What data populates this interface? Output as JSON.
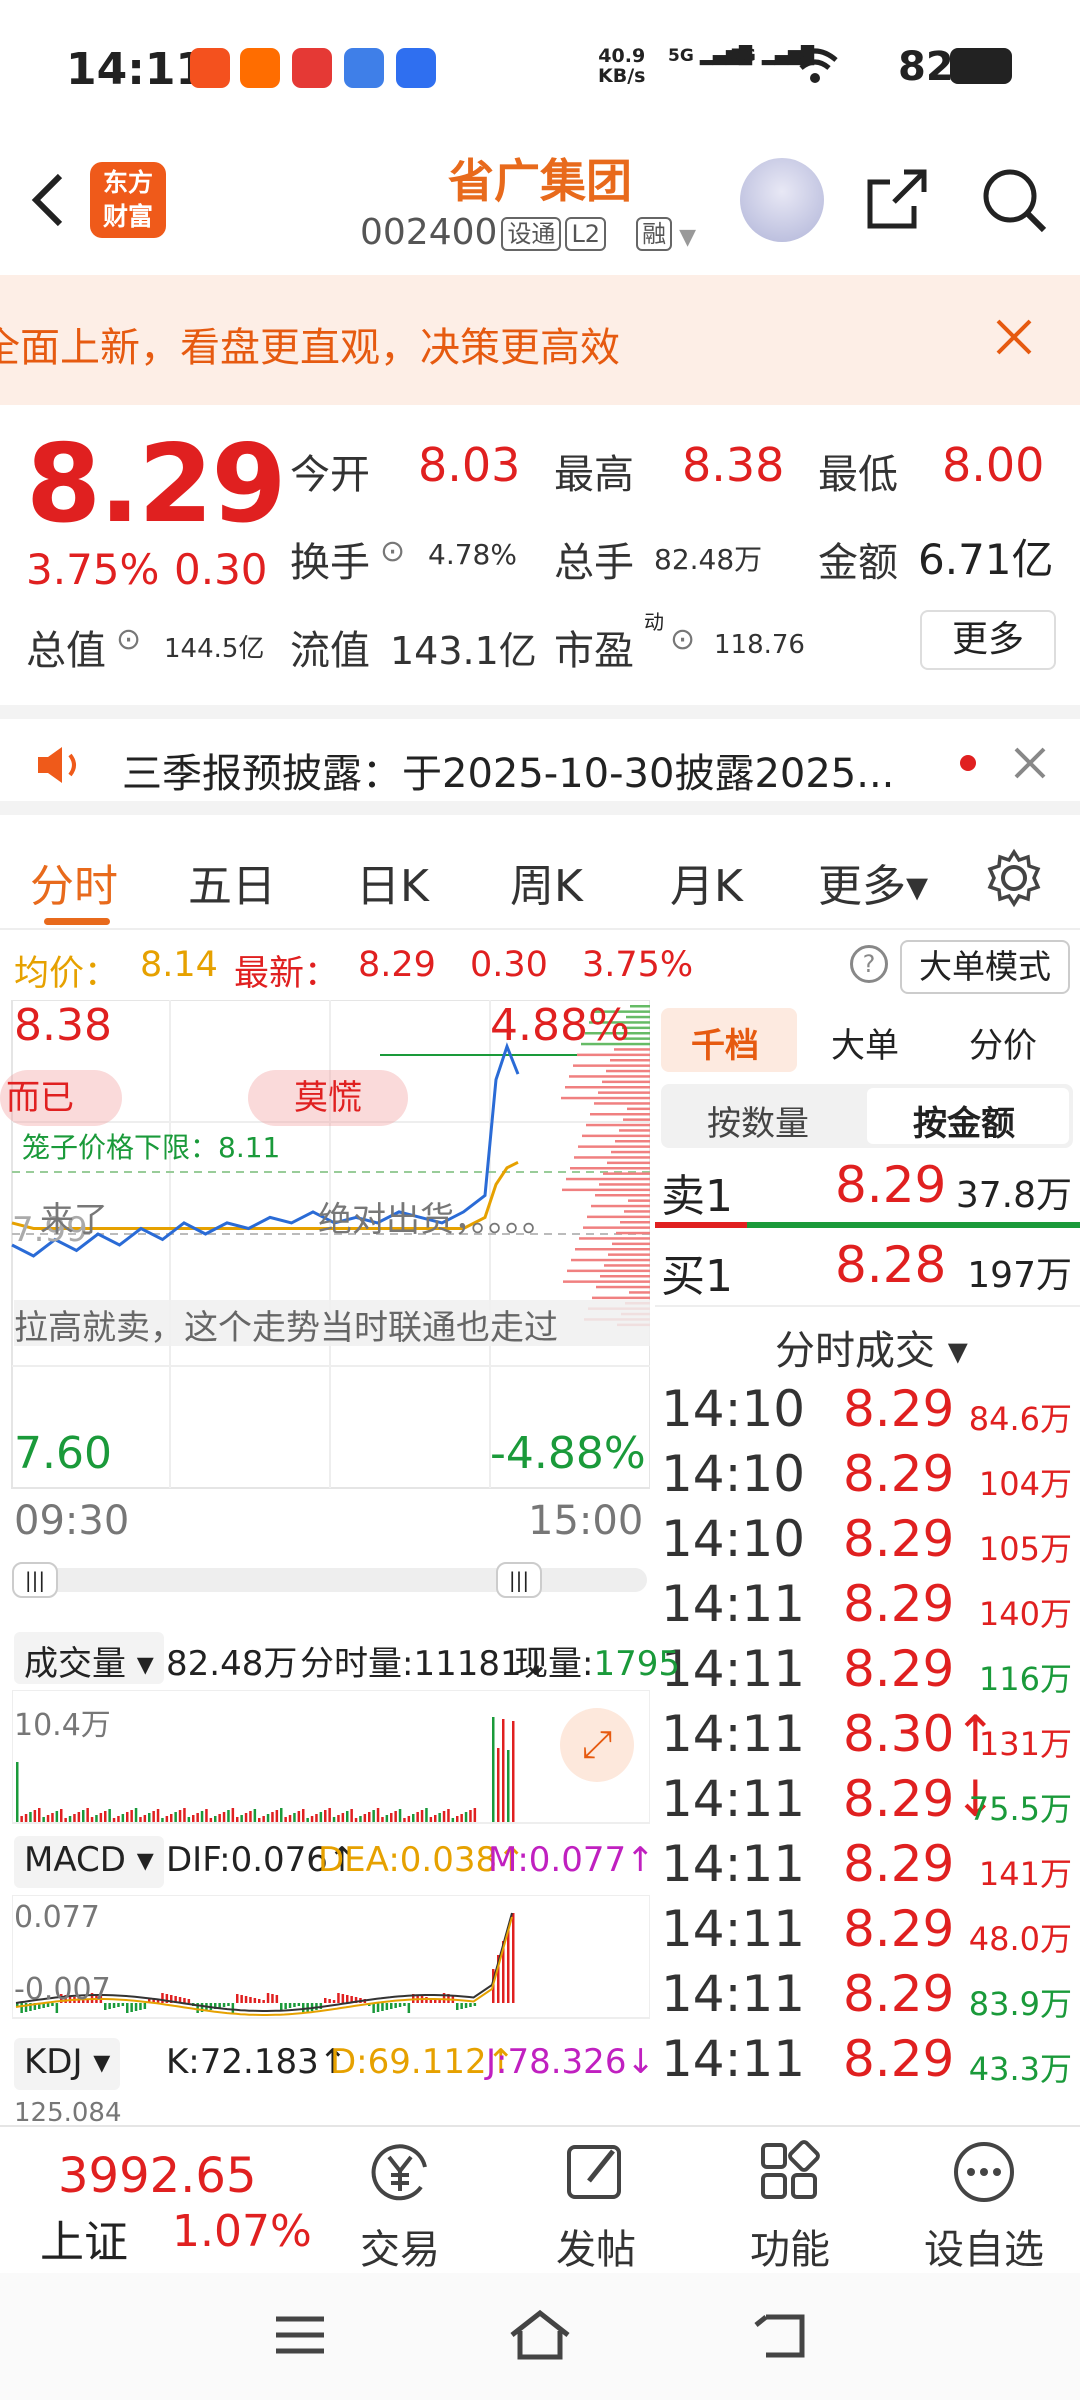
{
  "status_bar": {
    "time": "14:11",
    "net_speed_value": "40.9",
    "net_speed_unit": "KB/s",
    "sig1": "5G",
    "sig2": "5G",
    "battery": "82%"
  },
  "header": {
    "logo_line1": "东方",
    "logo_line2": "财富",
    "title": "省广集团",
    "code": "002400",
    "tag1": "设通",
    "tag2": "L2",
    "tag3": "融"
  },
  "banner": {
    "text": "全面上新，看盘更直观，决策更高效"
  },
  "quote": {
    "price": "8.29",
    "change_pct": "3.75%",
    "change": "0.30",
    "open_label": "今开",
    "open": "8.03",
    "high_label": "最高",
    "high": "8.38",
    "low_label": "最低",
    "low": "8.00",
    "turnover_label": "换手",
    "turnover": "4.78%",
    "volume_label": "总手",
    "volume": "82.48万",
    "amount_label": "金额",
    "amount": "6.71亿",
    "mcap_label": "总值",
    "mcap": "144.5亿",
    "float_label": "流值",
    "float": "143.1亿",
    "pe_label": "市盈",
    "pe_sup": "动",
    "pe": "118.76",
    "more": "更多"
  },
  "notice": {
    "text": "三季报预披露：于2025-10-30披露2025..."
  },
  "tabs": [
    {
      "label": "分时"
    },
    {
      "label": "五日"
    },
    {
      "label": "日K"
    },
    {
      "label": "周K"
    },
    {
      "label": "月K"
    },
    {
      "label": "更多▾"
    }
  ],
  "info_row": {
    "avg_label": "均价：",
    "avg": "8.14",
    "latest_label": "最新：",
    "latest": "8.29",
    "change": "0.30",
    "pct": "3.75%",
    "big_mode": "大单模式"
  },
  "chart": {
    "high": "8.38",
    "high_pct": "4.88%",
    "low": "7.60",
    "low_pct": "-4.88%",
    "ref": "7.99",
    "limit_line": "笼子价格下限：8.11",
    "t_start": "09:30",
    "t_end": "15:00",
    "danmu1": "而已",
    "danmu2": "莫慌",
    "danmu3": "来了",
    "danmu4": "绝对出货，。。。。",
    "danmu5": "拉高就卖，这个走势当时联通也走过"
  },
  "chart_data": {
    "type": "line",
    "title": "",
    "xlabel": "",
    "ylabel": "",
    "x_range": [
      "09:30",
      "15:00"
    ],
    "ylim": [
      7.6,
      8.38
    ],
    "reference_price": 7.99,
    "series": [
      {
        "values": [
          7.99,
          7.97,
          8.0,
          7.98,
          8.01,
          7.99,
          8.02,
          8.0,
          8.03,
          8.01,
          8.03,
          8.02,
          8.04,
          8.03,
          8.05,
          8.03,
          8.04,
          8.03,
          8.05,
          8.04,
          8.03,
          8.05,
          8.08,
          8.29,
          8.35,
          8.3
        ]
      },
      {
        "values": [
          8.03,
          8.02,
          8.02,
          8.02,
          8.02,
          8.02,
          8.02,
          8.02,
          8.02,
          8.02,
          8.02,
          8.02,
          8.02,
          8.02,
          8.02,
          8.02,
          8.02,
          8.02,
          8.02,
          8.02,
          8.02,
          8.02,
          8.04,
          8.1,
          8.13,
          8.14
        ]
      }
    ]
  },
  "right_panel": {
    "seg1": "千档",
    "seg2": "大单",
    "seg3": "分价",
    "btn1": "按数量",
    "btn2": "按金额",
    "sell_label": "卖1",
    "sell_price": "8.29",
    "sell_vol": "37.8万",
    "buy_label": "买1",
    "buy_price": "8.28",
    "buy_vol": "197万",
    "trades_title": "分时成交 ▾",
    "trades": [
      {
        "time": "14:10",
        "price": "8.29",
        "vol": "84.6万",
        "pc": "red",
        "vc": "red"
      },
      {
        "time": "14:10",
        "price": "8.29",
        "vol": "104万",
        "pc": "red",
        "vc": "red"
      },
      {
        "time": "14:10",
        "price": "8.29",
        "vol": "105万",
        "pc": "red",
        "vc": "red"
      },
      {
        "time": "14:11",
        "price": "8.29",
        "vol": "140万",
        "pc": "red",
        "vc": "red"
      },
      {
        "time": "14:11",
        "price": "8.29",
        "vol": "116万",
        "pc": "red",
        "vc": "green"
      },
      {
        "time": "14:11",
        "price": "8.30↑",
        "vol": "131万",
        "pc": "red",
        "vc": "red"
      },
      {
        "time": "14:11",
        "price": "8.29↓",
        "vol": "75.5万",
        "pc": "red",
        "vc": "green"
      },
      {
        "time": "14:11",
        "price": "8.29",
        "vol": "141万",
        "pc": "red",
        "vc": "red"
      },
      {
        "time": "14:11",
        "price": "8.29",
        "vol": "48.0万",
        "pc": "red",
        "vc": "red"
      },
      {
        "time": "14:11",
        "price": "8.29",
        "vol": "83.9万",
        "pc": "red",
        "vc": "green"
      },
      {
        "time": "14:11",
        "price": "8.29",
        "vol": "43.3万",
        "pc": "red",
        "vc": "green"
      }
    ]
  },
  "indicators": {
    "vol_select": "成交量 ▾",
    "vol_total": "82.48万",
    "vol_tick_label": "分时量:",
    "vol_tick": "11181↓",
    "vol_now_label": "现量:",
    "vol_now": "1795",
    "vol_max": "10.4万",
    "macd_select": "MACD ▾",
    "dif": "DIF:0.076↑",
    "dea": "DEA:0.038↑",
    "m": "M:0.077↑",
    "macd_top": "0.077",
    "macd_bottom": "-0.007",
    "kdj_select": "KDJ ▾",
    "k": "K:72.183↑",
    "d": "D:69.112↑",
    "j": "J:78.326↓",
    "kdj_top": "125.084"
  },
  "bottom_nav": {
    "index_value": "3992.65",
    "index_name": "上证",
    "index_pct": "1.07%",
    "trade": "交易",
    "post": "发帖",
    "func": "功能",
    "watch": "设自选"
  },
  "colors": {
    "up": "#e02020",
    "down": "#1a9a3a",
    "accent": "#e86a1c",
    "avg": "#e6a100"
  }
}
